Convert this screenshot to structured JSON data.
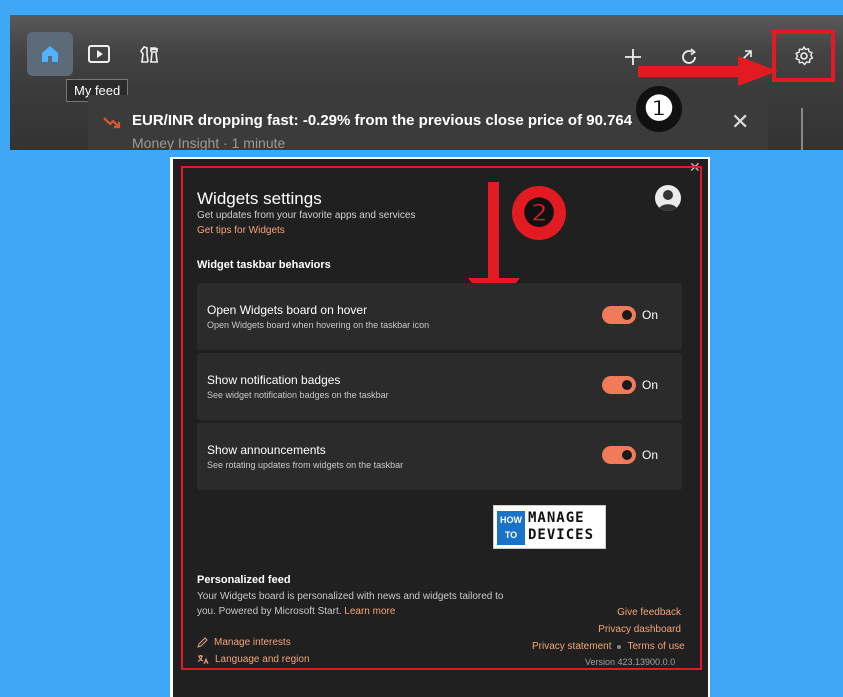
{
  "toolbar": {
    "tooltip": "My feed",
    "icons": [
      "home-icon",
      "video-icon",
      "chess-icon",
      "plus-icon",
      "refresh-icon",
      "expand-icon",
      "gear-icon"
    ]
  },
  "news": {
    "title": "EUR/INR dropping fast: -0.29% from the previous close price of 90.764",
    "source": "Money Insight · 1 minute"
  },
  "annotations": {
    "step1": "❶",
    "step2": "❷"
  },
  "panel": {
    "title": "Widgets settings",
    "subtitle": "Get updates from your favorite apps and services",
    "tips_link": "Get tips for Widgets",
    "section_title": "Widget taskbar behaviors",
    "settings": [
      {
        "title": "Open Widgets board on hover",
        "desc": "Open Widgets board when hovering on the taskbar icon",
        "state": "On"
      },
      {
        "title": "Show notification badges",
        "desc": "See widget notification badges on the taskbar",
        "state": "On"
      },
      {
        "title": "Show announcements",
        "desc": "See rotating updates from widgets on the taskbar",
        "state": "On"
      }
    ],
    "logo": {
      "how": "HOW",
      "to": "TO",
      "manage": "MANAGE",
      "devices": "DEVICES"
    },
    "feed_title": "Personalized feed",
    "feed_desc": "Your Widgets board is personalized with news and widgets tailored to you. Powered by Microsoft Start.",
    "learn_more": "Learn more",
    "manage_interests": "Manage interests",
    "language_region": "Language and region",
    "give_feedback": "Give feedback",
    "privacy_dashboard": "Privacy dashboard",
    "privacy_statement": "Privacy statement",
    "terms_of_use": "Terms of use",
    "version": "Version 423.13900.0.0"
  },
  "colors": {
    "background": "#3ea8f6",
    "panel": "#202020",
    "accent": "#f07a5a",
    "link": "#f3a57a",
    "annotation_red": "#e21a22"
  }
}
